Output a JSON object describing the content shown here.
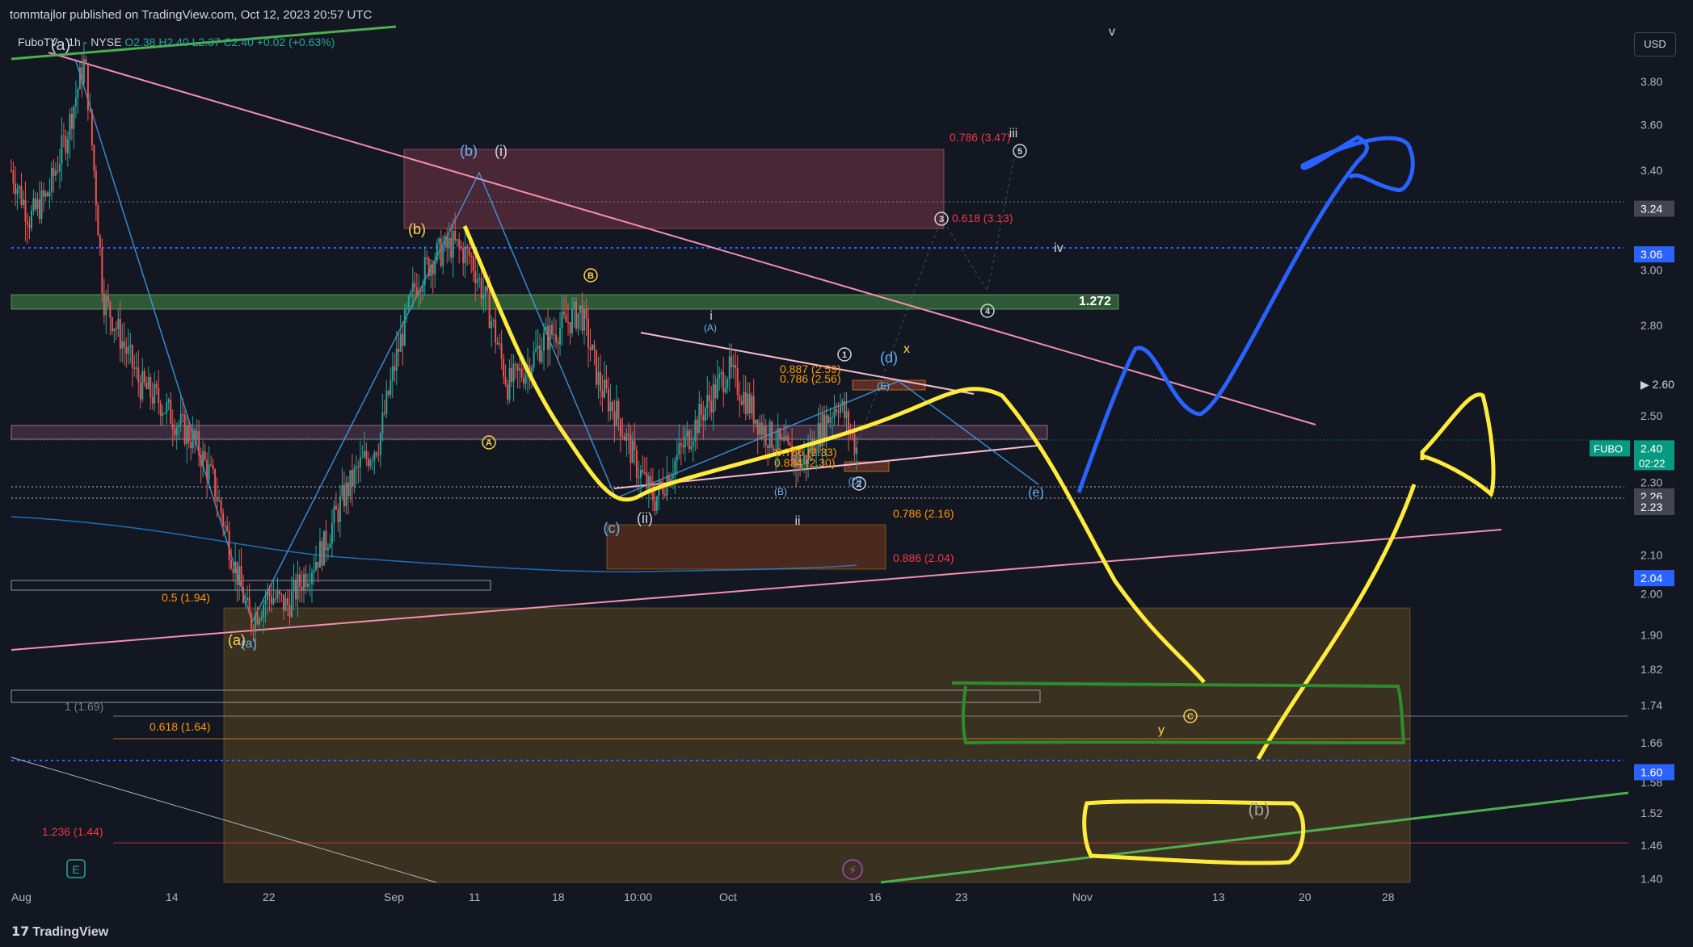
{
  "header": {
    "published_by": "tommtajlor published on TradingView.com, Oct 12, 2023 20:57 UTC"
  },
  "legend": {
    "symbol": "FuboTV",
    "interval": "1h",
    "exchange": "NYSE",
    "o": "O2.38",
    "h": "H2.40",
    "l": "L2.37",
    "c": "C2.40",
    "change": "+0.02 (+0.63%)"
  },
  "currency_button": "USD",
  "footer": {
    "brand": "TradingView"
  },
  "colors": {
    "bg": "#131722",
    "up": "#26a69a",
    "down": "#ef5350",
    "yellow": "#ffeb3b",
    "blue": "#2962ff",
    "green": "#2e8b2e",
    "pink": "#f48fb1"
  },
  "chart_data": {
    "type": "candlestick",
    "symbol": "FUBO",
    "yscale": "log",
    "ylim": [
      1.37,
      3.98
    ],
    "x_ticks": [
      "Aug",
      "14",
      "22",
      "Sep",
      "11",
      "18",
      "10:00",
      "Oct",
      "16",
      "23",
      "Nov",
      "13",
      "20",
      "28"
    ],
    "y_ticks": [
      "3.80",
      "3.60",
      "3.40",
      "3.00",
      "2.80",
      "2.50",
      "2.30",
      "2.10",
      "2.00",
      "1.90",
      "1.82",
      "1.74",
      "1.66",
      "1.58",
      "1.52",
      "1.46",
      "1.40"
    ],
    "price_labels": [
      {
        "text": "3.24",
        "value": 3.24,
        "color": "#434651"
      },
      {
        "text": "3.06",
        "value": 3.06,
        "color": "#2962ff"
      },
      {
        "text": "2.60",
        "value": 2.6,
        "color": ""
      },
      {
        "text": "FUBO",
        "value": 2.4,
        "color": "#089981"
      },
      {
        "text": "2.40",
        "value": 2.4,
        "color": "#089981"
      },
      {
        "text": "02:22",
        "value": 2.4,
        "color": "#089981"
      },
      {
        "text": "2.26",
        "value": 2.26,
        "color": "#434651"
      },
      {
        "text": "2.23",
        "value": 2.23,
        "color": "#434651"
      },
      {
        "text": "2.04",
        "value": 2.04,
        "color": "#2962ff"
      },
      {
        "text": "1.60",
        "value": 1.6,
        "color": "#2962ff"
      }
    ],
    "fib_labels": [
      {
        "text": "0.786 (3.47)",
        "color": "#f23645"
      },
      {
        "text": "0.618 (3.13)",
        "color": "#f23645"
      },
      {
        "text": "1.272",
        "color": "#ffffff"
      },
      {
        "text": "0.887 (2.59)",
        "color": "#ff9800"
      },
      {
        "text": "0.786 (2.56)",
        "color": "#ff9800"
      },
      {
        "text": "0.786 (2.16)",
        "color": "#ff9800"
      },
      {
        "text": "0.886 (2.04)",
        "color": "#f23645"
      },
      {
        "text": "0.5 (1.94)",
        "color": "#ff9800"
      },
      {
        "text": "1 (1.69)",
        "color": "#787b86"
      },
      {
        "text": "0.618 (1.64)",
        "color": "#ff9800"
      },
      {
        "text": "1.236 (1.44)",
        "color": "#f23645"
      },
      {
        "text": "0.786 (2.33)",
        "color": "#ff9800"
      },
      {
        "text": "0.834 (2.30)",
        "color": "#ff9800"
      }
    ],
    "wave_labels": [
      "(a)",
      "(b)",
      "(i)",
      "(b)",
      "(c)",
      "(ii)",
      "(a)",
      "(a)",
      "i",
      "ii",
      "iii",
      "iv",
      "v",
      "(d)",
      "(e)",
      "(b)",
      "x",
      "y",
      "A",
      "B",
      "C",
      "1",
      "2",
      "3",
      "4",
      "5",
      "(A)",
      "(B)",
      "(E)",
      "(D)"
    ],
    "close_path": [
      [
        "2023-08-01",
        3.4
      ],
      [
        "2023-08-03",
        3.2
      ],
      [
        "2023-08-05",
        3.3
      ],
      [
        "2023-08-07",
        3.55
      ],
      [
        "2023-08-08",
        3.9
      ],
      [
        "2023-08-09",
        2.9
      ],
      [
        "2023-08-10",
        2.75
      ],
      [
        "2023-08-11",
        2.6
      ],
      [
        "2023-08-13",
        2.55
      ],
      [
        "2023-08-15",
        2.48
      ],
      [
        "2023-08-16",
        2.42
      ],
      [
        "2023-08-17",
        2.3
      ],
      [
        "2023-08-18",
        2.1
      ],
      [
        "2023-08-19",
        1.93
      ],
      [
        "2023-08-21",
        2.0
      ],
      [
        "2023-08-22",
        1.97
      ],
      [
        "2023-08-24",
        2.05
      ],
      [
        "2023-08-26",
        2.12
      ],
      [
        "2023-08-28",
        2.25
      ],
      [
        "2023-08-30",
        2.35
      ],
      [
        "2023-09-01",
        2.42
      ],
      [
        "2023-09-03",
        2.7
      ],
      [
        "2023-09-05",
        2.95
      ],
      [
        "2023-09-07",
        3.05
      ],
      [
        "2023-09-09",
        3.1
      ],
      [
        "2023-09-11",
        3.05
      ],
      [
        "2023-09-12",
        2.85
      ],
      [
        "2023-09-13",
        2.6
      ],
      [
        "2023-09-15",
        2.65
      ],
      [
        "2023-09-17",
        2.75
      ],
      [
        "2023-09-19",
        2.8
      ],
      [
        "2023-09-21",
        2.85
      ],
      [
        "2023-09-23",
        2.6
      ],
      [
        "2023-09-25",
        2.5
      ],
      [
        "2023-09-26",
        2.35
      ],
      [
        "2023-09-27",
        2.25
      ],
      [
        "2023-09-29",
        2.35
      ],
      [
        "2023-10-01",
        2.45
      ],
      [
        "2023-10-03",
        2.55
      ],
      [
        "2023-10-04",
        2.65
      ],
      [
        "2023-10-05",
        2.55
      ],
      [
        "2023-10-06",
        2.45
      ],
      [
        "2023-10-08",
        2.4
      ],
      [
        "2023-10-09",
        2.35
      ],
      [
        "2023-10-10",
        2.45
      ],
      [
        "2023-10-11",
        2.55
      ],
      [
        "2023-10-12",
        2.4
      ]
    ]
  }
}
